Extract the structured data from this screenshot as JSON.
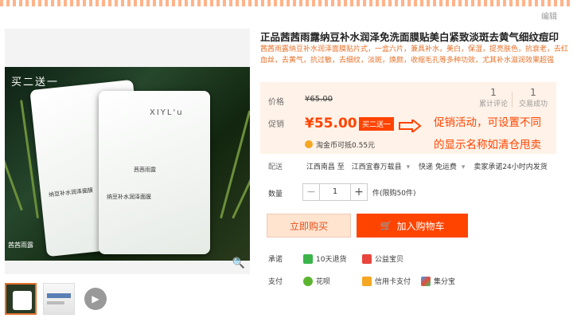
{
  "header": {
    "edit_label": "编辑"
  },
  "gallery": {
    "overlay_top": "买二送一",
    "overlay_bottom": "茜茜雨露",
    "brand": "XIYL'u",
    "packet_label": "茜茜雨露",
    "packet_name": "纳豆补水润泽面膜",
    "zoom_icon": "zoom-icon",
    "video_icon": "play-icon"
  },
  "product": {
    "title": "正品茜茜雨露纳豆补水润泽免洗面膜贴美白紧致淡斑去黄气细纹痘印",
    "subtitle": "茜茜雨露纳豆补水润泽面膜贴片式，一盒六片，兼具补水，美白，保湿，提亮肤色，抗衰老，去红血丝，去黄气，抗过敏，去细纹，淡斑，焕颜，收缩毛孔等多种功效，尤其补水滋润效果超强"
  },
  "price": {
    "price_label": "价格",
    "original": "¥65.00",
    "promo_label": "促销",
    "promo": "¥55.00",
    "promo_badge": "买二送一",
    "taojin": "淘金币可抵0.55元",
    "reviews_count": "1",
    "reviews_label": "累计评论",
    "deals_count": "1",
    "deals_label": "交易成功"
  },
  "annotation": {
    "line1": "促销活动，可设置不同",
    "line2": "的显示名称如清仓甩卖"
  },
  "delivery": {
    "label": "配送",
    "from": "江西南昌 至",
    "to": "江西宜春万载县",
    "express": "快递 免运费",
    "promise": "卖家承诺24小时内发货"
  },
  "quantity": {
    "label": "数量",
    "value": "1",
    "note": "件(限购50件)"
  },
  "buttons": {
    "buy": "立即购买",
    "cart": "加入购物车"
  },
  "services": {
    "promise_label": "承诺",
    "returns": "10天退货",
    "charity": "公益宝贝",
    "pay_label": "支付",
    "huabei": "花呗",
    "credit": "信用卡支付",
    "jifen": "集分宝"
  },
  "colors": {
    "accent": "#ff4400",
    "bg_price": "#fff2e8"
  }
}
